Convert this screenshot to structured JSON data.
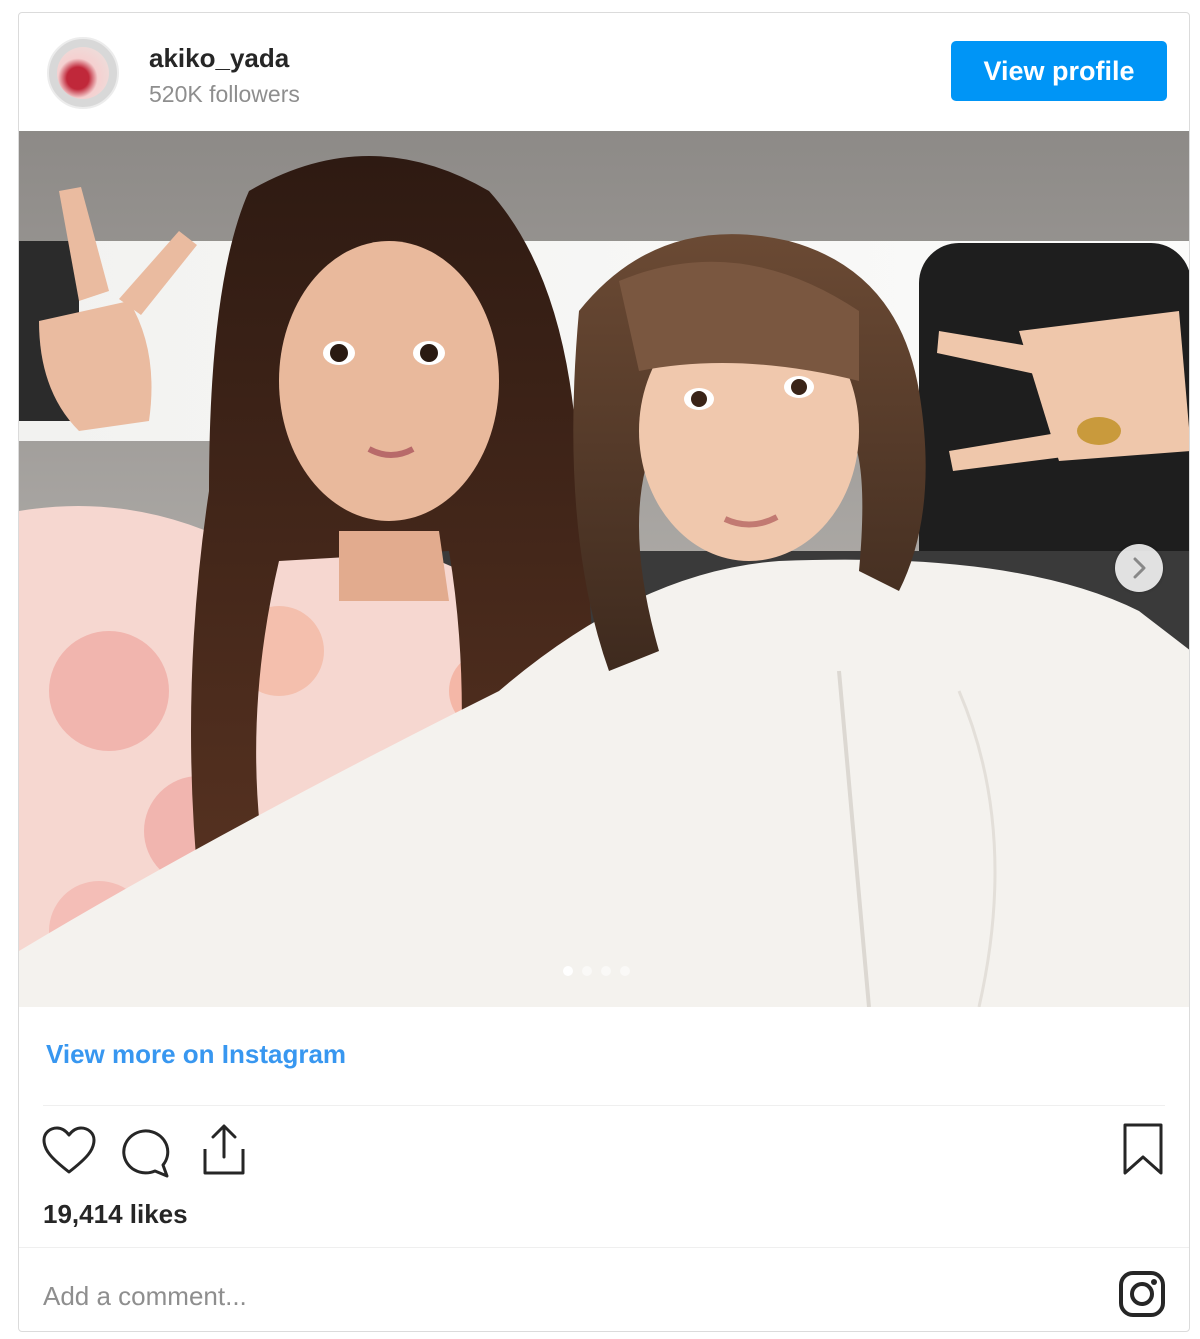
{
  "header": {
    "username": "akiko_yada",
    "followers": "520K followers",
    "view_profile_label": "View profile"
  },
  "post": {
    "image_alt": "Two women taking a selfie in a car making peace signs",
    "carousel": {
      "total": 4,
      "active_index": 0
    },
    "view_more_label": "View more on Instagram",
    "likes": "19,414 likes",
    "comment_placeholder": "Add a comment..."
  },
  "icons": {
    "like": "heart-icon",
    "comment": "comment-icon",
    "share": "share-icon",
    "save": "bookmark-icon",
    "brand": "instagram-icon",
    "next": "chevron-right-icon"
  },
  "colors": {
    "accent": "#0095f6",
    "link": "#3897f0",
    "text": "#262626",
    "muted": "#8e8e8e"
  }
}
